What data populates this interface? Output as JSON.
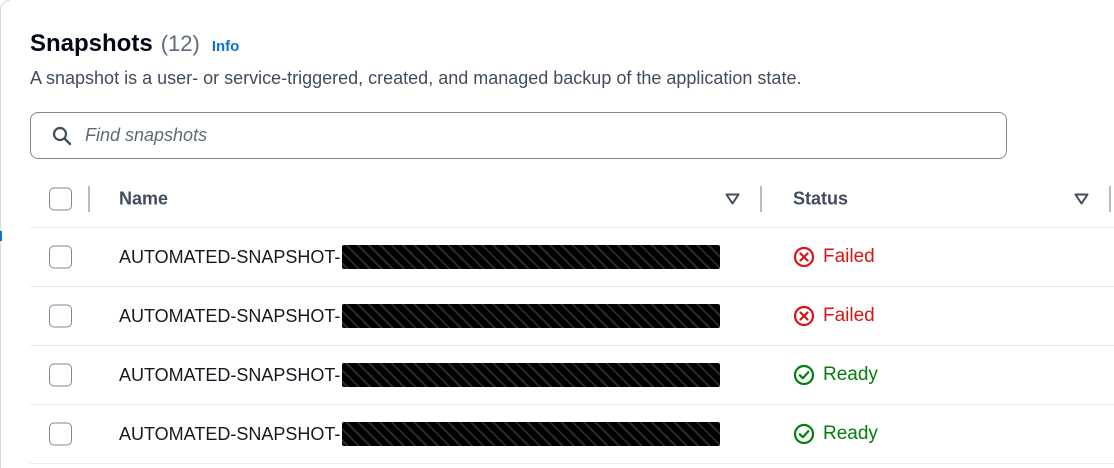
{
  "colors": {
    "accent": "#0972d3",
    "failed": "#d91515",
    "ready": "#037f0c"
  },
  "header": {
    "title": "Snapshots",
    "count": "(12)",
    "info_label": "Info",
    "description": "A snapshot is a user- or service-triggered, created, and managed backup of the application state."
  },
  "search": {
    "placeholder": "Find snapshots",
    "value": "",
    "icon": "search-icon"
  },
  "table": {
    "columns": [
      {
        "label": "Name",
        "sort_icon": "sort-down-icon"
      },
      {
        "label": "Status",
        "sort_icon": "sort-down-icon"
      }
    ],
    "rows": [
      {
        "name": "AUTOMATED-SNAPSHOT-",
        "name_redacted": true,
        "status": "Failed",
        "status_icon": "error-circle-icon"
      },
      {
        "name": "AUTOMATED-SNAPSHOT-",
        "name_redacted": true,
        "status": "Failed",
        "status_icon": "error-circle-icon"
      },
      {
        "name": "AUTOMATED-SNAPSHOT-",
        "name_redacted": true,
        "status": "Ready",
        "status_icon": "check-circle-icon"
      },
      {
        "name": "AUTOMATED-SNAPSHOT-",
        "name_redacted": true,
        "status": "Ready",
        "status_icon": "check-circle-icon"
      }
    ]
  }
}
